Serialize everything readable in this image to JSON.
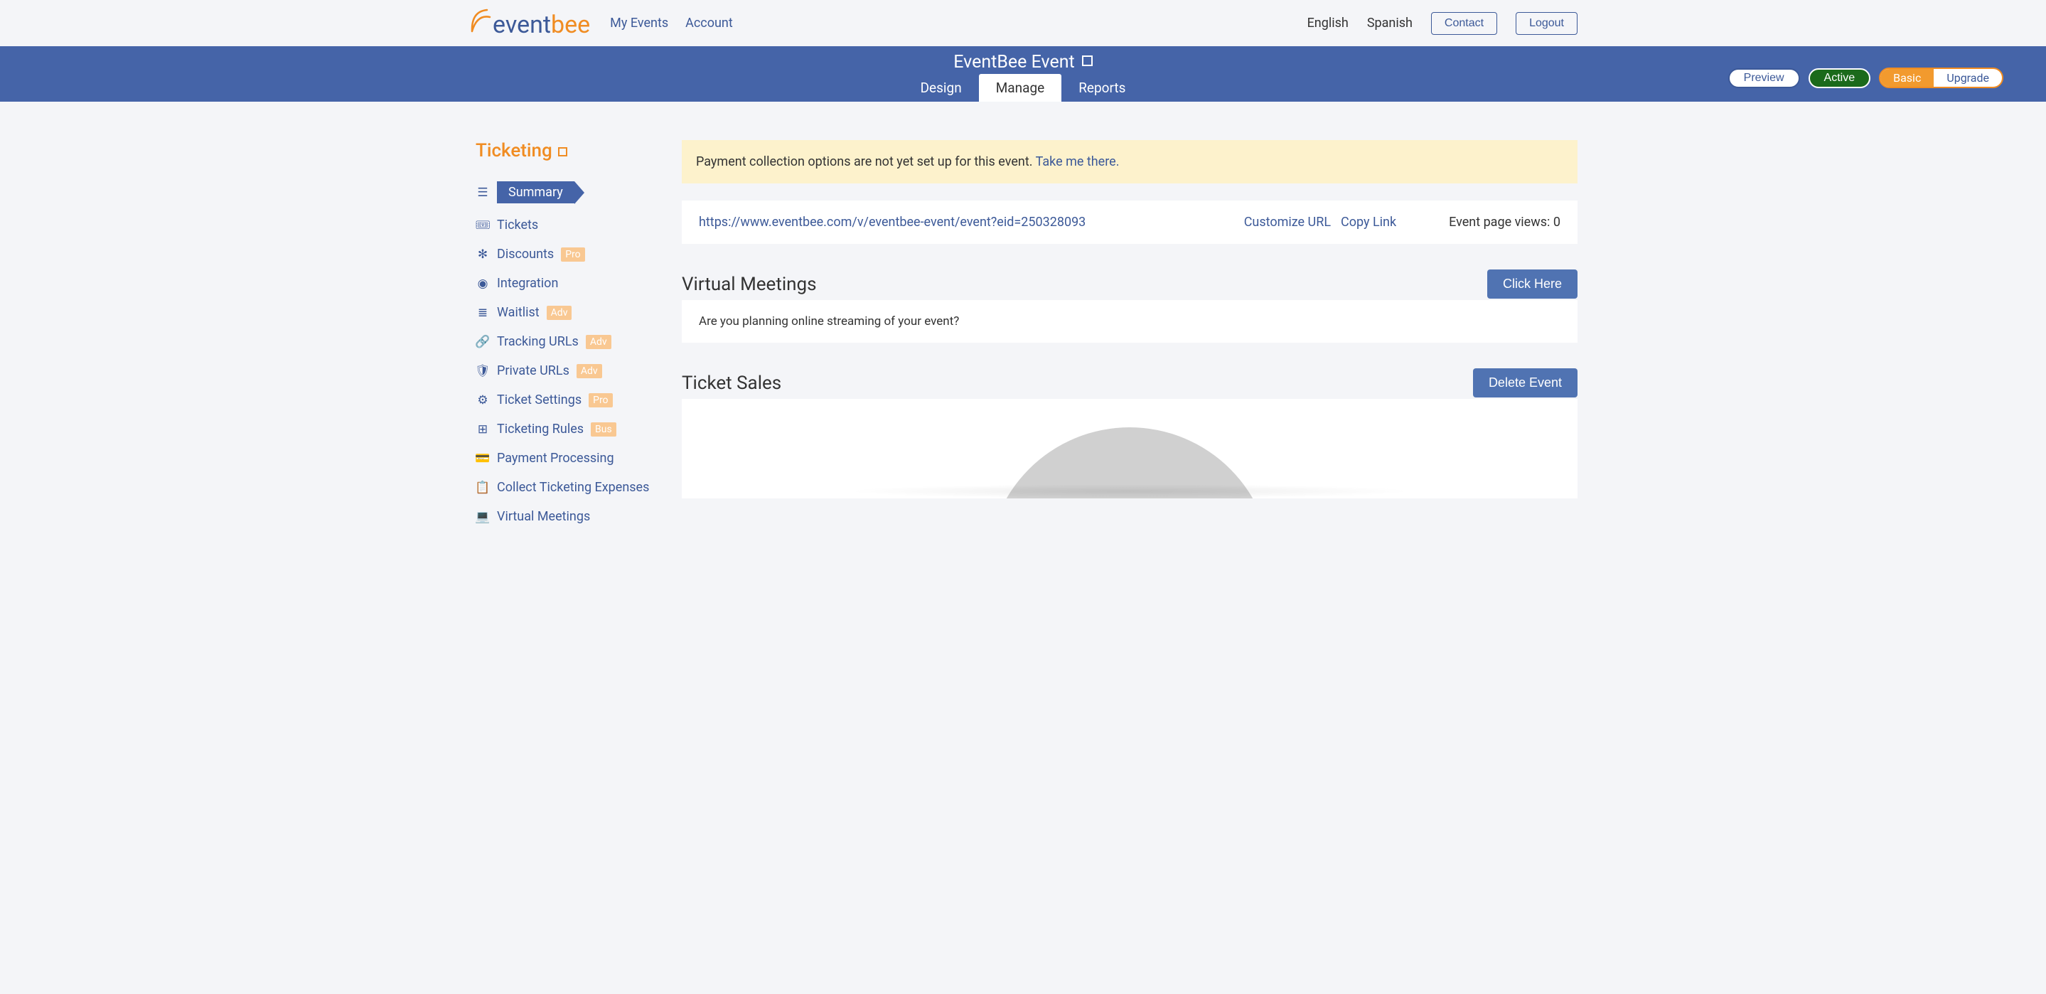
{
  "brand": {
    "t1": "event",
    "t2": "bee"
  },
  "topnav": {
    "myEvents": "My Events",
    "account": "Account"
  },
  "languages": {
    "en": "English",
    "es": "Spanish"
  },
  "buttons": {
    "contact": "Contact",
    "logout": "Logout",
    "preview": "Preview",
    "activeStatus": "Active",
    "basic": "Basic",
    "upgrade": "Upgrade",
    "clickHere": "Click Here",
    "deleteEvent": "Delete Event"
  },
  "eventTitle": "EventBee Event",
  "tabs": {
    "design": "Design",
    "manage": "Manage",
    "reports": "Reports"
  },
  "sidebar": {
    "section": "Ticketing",
    "items": [
      {
        "label": "Summary",
        "active": true
      },
      {
        "label": "Tickets"
      },
      {
        "label": "Discounts",
        "badge": "Pro"
      },
      {
        "label": "Integration"
      },
      {
        "label": "Waitlist",
        "badge": "Adv"
      },
      {
        "label": "Tracking URLs",
        "badge": "Adv"
      },
      {
        "label": "Private URLs",
        "badge": "Adv"
      },
      {
        "label": "Ticket Settings",
        "badge": "Pro"
      },
      {
        "label": "Ticketing Rules",
        "badge": "Bus"
      },
      {
        "label": "Payment Processing"
      },
      {
        "label": "Collect Ticketing Expenses"
      },
      {
        "label": "Virtual Meetings"
      }
    ]
  },
  "alert": {
    "text": "Payment collection options are not yet set up for this event. ",
    "link": "Take me there."
  },
  "urlCard": {
    "url": "https://www.eventbee.com/v/eventbee-event/event?eid=250328093",
    "customize": "Customize URL",
    "copy": "Copy Link",
    "viewsLabel": "Event page views: ",
    "viewsCount": "0"
  },
  "sections": {
    "virtualMeetings": {
      "title": "Virtual Meetings",
      "text": "Are you planning online streaming of your event?"
    },
    "ticketSales": {
      "title": "Ticket Sales"
    }
  },
  "icons": {
    "summary": "☰",
    "tickets": "🎟",
    "discounts": "✻",
    "integration": "◉",
    "waitlist": "≣",
    "tracking": "🔗",
    "private": "🛡",
    "settings": "⚙",
    "rules": "⊞",
    "payment": "💳",
    "collect": "📋",
    "virtual": "💻"
  }
}
